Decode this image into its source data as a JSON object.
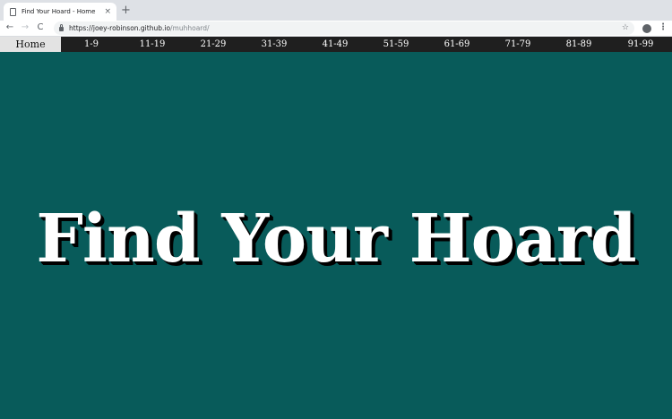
{
  "browser": {
    "tab_title": "Find Your Hoard - Home",
    "tab_close": "×",
    "new_tab": "+",
    "url_host": "https://joey-robinson.github.io",
    "url_path": "/muhhoard/",
    "back": "←",
    "forward": "→",
    "reload": "C",
    "bookmark": "☆",
    "menu": "⋮"
  },
  "nav": {
    "home": "Home",
    "items": [
      "1-9",
      "11-19",
      "21-29",
      "31-39",
      "41-49",
      "51-59",
      "61-69",
      "71-79",
      "81-89",
      "91-99"
    ]
  },
  "hero": {
    "title": "Find Your Hoard"
  },
  "colors": {
    "background": "#085b5a",
    "nav_bg": "#1f1f1f",
    "home_bg": "#e3e3e3"
  }
}
